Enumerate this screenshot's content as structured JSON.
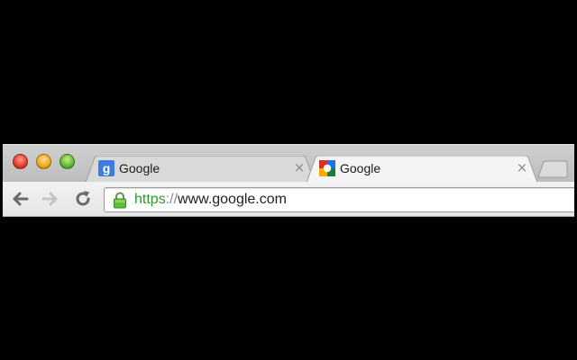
{
  "window": {
    "controls": {
      "close": "close-button",
      "minimize": "minimize-button",
      "zoom": "zoom-button"
    }
  },
  "tabs": [
    {
      "title": "Google",
      "favicon": "google-g-icon",
      "active": false,
      "close_label": "×"
    },
    {
      "title": "Google",
      "favicon": "google-colorful-icon",
      "active": true,
      "close_label": "×"
    }
  ],
  "toolbar": {
    "back_icon": "arrow-left-icon",
    "forward_icon": "arrow-right-icon",
    "reload_icon": "reload-icon"
  },
  "omnibox": {
    "scheme": "https",
    "separator": "://",
    "host": "www.google.com",
    "secure": true,
    "lock_icon": "lock-icon"
  },
  "colors": {
    "secure_green": "#2c9a2c",
    "close_red": "#e23c2c",
    "minimize_yellow": "#f2a71b",
    "zoom_green": "#5cb830"
  }
}
